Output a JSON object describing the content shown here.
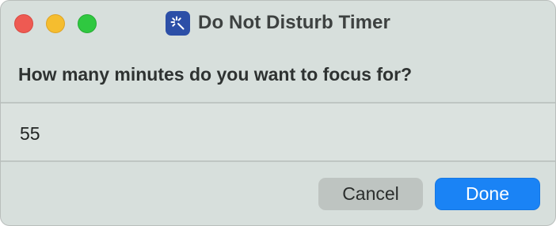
{
  "window": {
    "title": "Do Not Disturb Timer",
    "app_icon": "sparkle-wand-icon",
    "accent_color": "#1a83f5",
    "icon_color": "#2c4fa7"
  },
  "dialog": {
    "prompt": "How many minutes do you want to focus for?",
    "input_value": "55"
  },
  "buttons": {
    "cancel_label": "Cancel",
    "done_label": "Done"
  }
}
